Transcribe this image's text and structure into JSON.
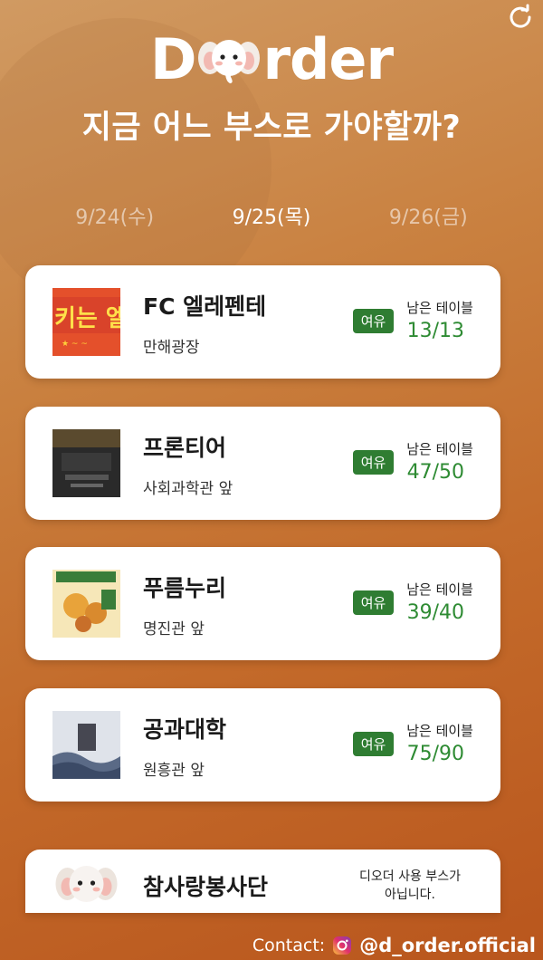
{
  "logo": {
    "text_left": "D",
    "text_right": "rder",
    "mascot_icon": "elephant-mascot-icon"
  },
  "headline": "지금 어느 부스로 가야할까?",
  "dates": [
    {
      "label": "9/24(수)",
      "active": false
    },
    {
      "label": "9/25(목)",
      "active": true
    },
    {
      "label": "9/26(금)",
      "active": false
    }
  ],
  "remaining_label": "남은 테이블",
  "booths": [
    {
      "name": "FC 엘레펜테",
      "location": "만해광장",
      "badge": "여유",
      "remaining": "13/13",
      "thumb_icon": "fc-elefante-poster"
    },
    {
      "name": "프론티어",
      "location": "사회과학관 앞",
      "badge": "여유",
      "remaining": "47/50",
      "thumb_icon": "frontier-poster"
    },
    {
      "name": "푸름누리",
      "location": "명진관 앞",
      "badge": "여유",
      "remaining": "39/40",
      "thumb_icon": "pureumnuri-poster"
    },
    {
      "name": "공과대학",
      "location": "원흥관 앞",
      "badge": "여유",
      "remaining": "75/90",
      "thumb_icon": "engineering-poster"
    }
  ],
  "non_user_booth": {
    "name": "참사랑봉사단",
    "notice_line1": "디오더 사용 부스가",
    "notice_line2": "아닙니다."
  },
  "footer": {
    "contact_label": "Contact:",
    "handle": "@d_order.official"
  },
  "colors": {
    "accent_green": "#2f7d32",
    "count_green": "#2e8b33",
    "bg_orange": "#c36a2a"
  }
}
